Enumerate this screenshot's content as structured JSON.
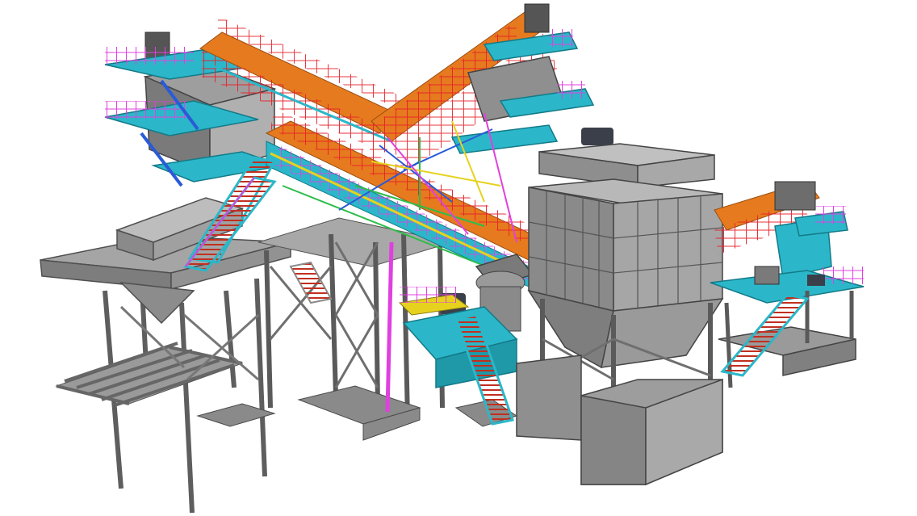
{
  "scene": {
    "subject": "",
    "view": "",
    "background_color": "#ffffff",
    "colors": {
      "steel_gray": "#8c8c8c",
      "steel_dark": "#6b6b6b",
      "steel_light": "#b5b5b5",
      "walkway_cyan": "#2bb7c9",
      "handrail_red": "#e8242c",
      "handrail_magenta": "#e040e0",
      "stair_yellow": "#e6d21e",
      "conveyor_orange": "#e67a1e",
      "frame_blue": "#2a5bd7",
      "frame_green": "#2dbd4a",
      "motor_dark": "#3a3f4a"
    },
    "components": [
      {
        "name": "left-feed-hopper"
      },
      {
        "name": "left-support-grid"
      },
      {
        "name": "central-trestle"
      },
      {
        "name": "upper-left-screen-house"
      },
      {
        "name": "diagonal-conveyor-left"
      },
      {
        "name": "diagonal-conveyor-right"
      },
      {
        "name": "main-cross-conveyor"
      },
      {
        "name": "central-bin-silo"
      },
      {
        "name": "right-conveyor-and-platform"
      },
      {
        "name": "crusher-unit"
      },
      {
        "name": "access-stairs"
      }
    ]
  }
}
